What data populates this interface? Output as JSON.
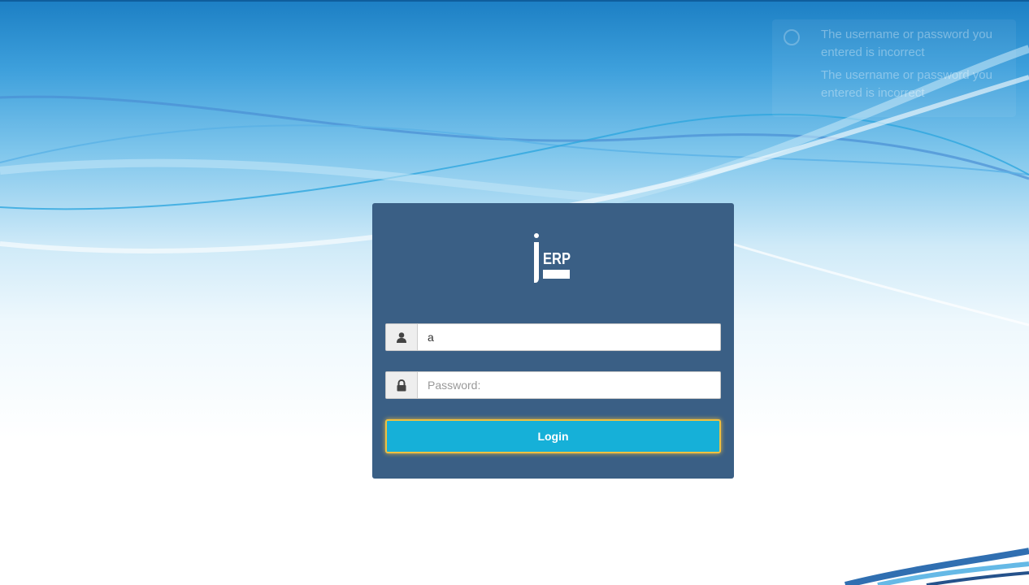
{
  "logo": {
    "text": "ERP"
  },
  "username": {
    "value": "a",
    "icon": "user-icon"
  },
  "password": {
    "placeholder": "Password:",
    "value": "",
    "icon": "lock-icon"
  },
  "login_button": {
    "label": "Login"
  },
  "faded_message": {
    "line1": "The username or password you entered is incorrect",
    "line2": "The username or password you entered is incorrect"
  },
  "colors": {
    "panel": "#3a5f85",
    "button": "#16b0d8",
    "button_focus": "#f0c040"
  }
}
